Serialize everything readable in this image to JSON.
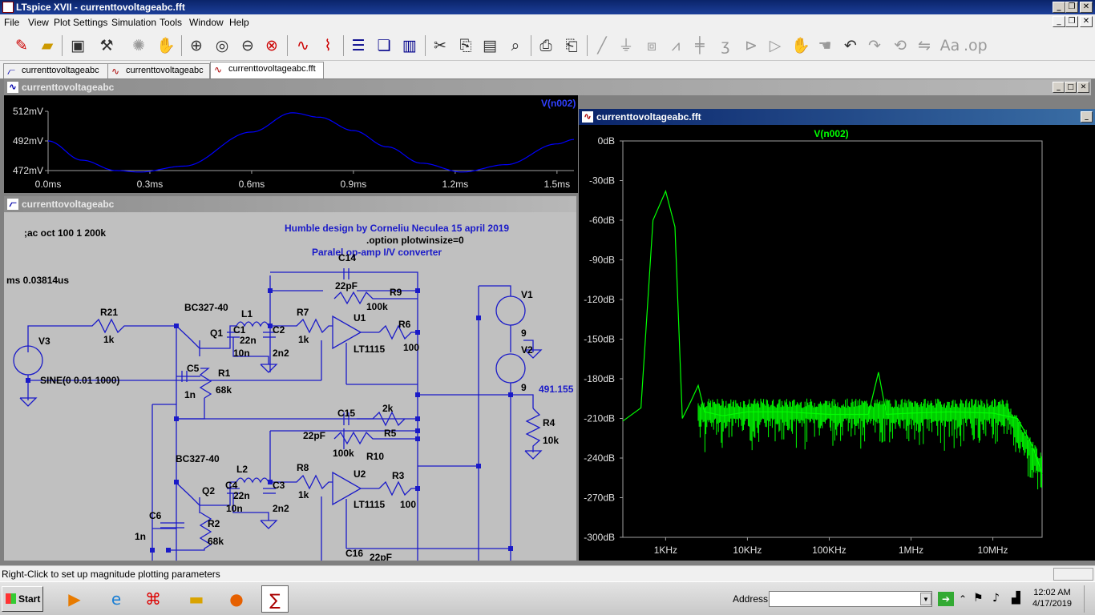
{
  "window": {
    "title": "LTspice XVII - currenttovoltageabc.fft"
  },
  "menu": [
    "File",
    "View",
    "Plot Settings",
    "Simulation",
    "Tools",
    "Window",
    "Help"
  ],
  "toolbar": {
    "icons": [
      "new-schematic-icon",
      "open-icon",
      "save-icon",
      "control-panel-icon",
      "run-icon",
      "halt-icon",
      "zoom-in-icon",
      "zoom-extents-icon",
      "zoom-out-icon",
      "zoom-cancel-icon",
      "autorange-icon",
      "plot-wizard-icon",
      "tile-horizontal-icon",
      "cascade-icon",
      "tile-vertical-icon",
      "cut-icon",
      "copy-icon",
      "paste-icon",
      "find-icon",
      "print-icon",
      "print-setup-icon",
      "wire-icon",
      "ground-icon",
      "label-net-icon",
      "resistor-icon",
      "capacitor-icon",
      "inductor-icon",
      "diode-icon",
      "component-icon",
      "move-icon",
      "drag-icon",
      "undo-icon",
      "redo-icon",
      "rotate-icon",
      "mirror-icon",
      "text-icon",
      "spice-directive-icon"
    ]
  },
  "tabs": [
    {
      "label": "currenttovoltageabc",
      "icon": "schematic-icon"
    },
    {
      "label": "currenttovoltageabc",
      "icon": "waveform-icon"
    },
    {
      "label": "currenttovoltageabc.fft",
      "icon": "waveform-icon"
    }
  ],
  "time_window": {
    "title": "currenttovoltageabc",
    "trace_label": "V(n002)",
    "trace_color": "#0000ff",
    "chart_data": {
      "type": "line",
      "xlabel": "",
      "ylabel": "",
      "x_ticks": [
        "0.0ms",
        "0.3ms",
        "0.6ms",
        "0.9ms",
        "1.2ms",
        "1.5ms"
      ],
      "y_ticks": [
        "512mV",
        "492mV",
        "472mV"
      ],
      "xlim": [
        0,
        1.55
      ],
      "ylim": [
        472,
        512
      ],
      "series": [
        {
          "name": "V(n002)",
          "x": [
            0,
            0.1,
            0.2,
            0.27,
            0.4,
            0.6,
            0.72,
            0.8,
            0.9,
            1.0,
            1.1,
            1.22,
            1.35,
            1.5,
            1.55
          ],
          "y": [
            492,
            479,
            472,
            471,
            475,
            498,
            511,
            508,
            499,
            488,
            477,
            471,
            476,
            490,
            493
          ]
        }
      ]
    }
  },
  "schematic_window": {
    "title": "currenttovoltageabc",
    "texts": {
      "ac": ";ac oct 100 1 200k",
      "ms": "ms 0.03814us",
      "humble": "Humble design by Corneliu Neculea 15 april 2019",
      "option": ".option plotwinsize=0",
      "paralel": "Paralel op-amp I/V converter",
      "c14": "C14",
      "c14v": "22pF",
      "r9": "R9",
      "r9v": "100k",
      "v1": "V1",
      "v1v": "9",
      "v2": "V2",
      "v2v": "9",
      "r21": "R21",
      "r21v": "1k",
      "bc1": "BC327-40",
      "l1": "L1",
      "q1": "Q1",
      "c1": "C1",
      "c1v": "10n",
      "l1v": "22n",
      "c2": "C2",
      "c2v": "2n2",
      "r7": "R7",
      "r7v": "1k",
      "u1": "U1",
      "u1v": "LT1115",
      "r6": "R6",
      "r6v": "100",
      "v3": "V3",
      "sine": "SINE(0 0.01 1000)",
      "c5": "C5",
      "c5v": "1n",
      "r1": "R1",
      "r1v": "68k",
      "netval": "491.155",
      "r4": "R4",
      "r4v": "10k",
      "c15": "C15",
      "c15v": "2k",
      "r5": "R5",
      "c22": "22pF",
      "r10v": "100k",
      "r10": "R10",
      "bc2": "BC327-40",
      "l2": "L2",
      "q2": "Q2",
      "c4": "C4",
      "l2v": "22n",
      "c4v": "10n",
      "c3": "C3",
      "c3v": "2n2",
      "r8": "R8",
      "r8v": "1k",
      "u2": "U2",
      "u2v": "LT1115",
      "r3": "R3",
      "r3v": "100",
      "c6": "C6",
      "c6v": "1n",
      "r2": "R2",
      "r2v": "68k",
      "c16": "C16",
      "c16v": "22pF"
    }
  },
  "fft_window": {
    "title": "currenttovoltageabc.fft",
    "trace_label": "V(n002)",
    "trace_color": "#00ff00",
    "chart_data": {
      "type": "line",
      "xlabel": "",
      "ylabel": "",
      "x_scale": "log",
      "x_ticks": [
        "1KHz",
        "10KHz",
        "100KHz",
        "1MHz",
        "10MHz"
      ],
      "y_ticks": [
        "0dB",
        "-30dB",
        "-60dB",
        "-90dB",
        "-120dB",
        "-150dB",
        "-180dB",
        "-210dB",
        "-240dB",
        "-270dB",
        "-300dB"
      ],
      "ylim": [
        -300,
        0
      ],
      "series": [
        {
          "name": "V(n002)",
          "x_hz": [
            300,
            500,
            700,
            1000,
            1300,
            1600,
            2000,
            2500,
            3000,
            5000,
            10000,
            30000,
            100000,
            300000,
            400000,
            500000,
            1000000,
            3000000,
            10000000,
            20000000,
            30000000,
            40000000
          ],
          "y": [
            -212,
            -202,
            -60,
            -38,
            -65,
            -210,
            -198,
            -185,
            -205,
            -208,
            -205,
            -205,
            -207,
            -207,
            -175,
            -207,
            -206,
            -205,
            -206,
            -210,
            -230,
            -252
          ]
        }
      ]
    }
  },
  "status": {
    "text": "Right-Click to set up magnitude plotting parameters"
  },
  "taskbar": {
    "start": "Start",
    "address_label": "Address",
    "address_value": "",
    "time": "12:02 AM",
    "date": "4/17/2019"
  }
}
